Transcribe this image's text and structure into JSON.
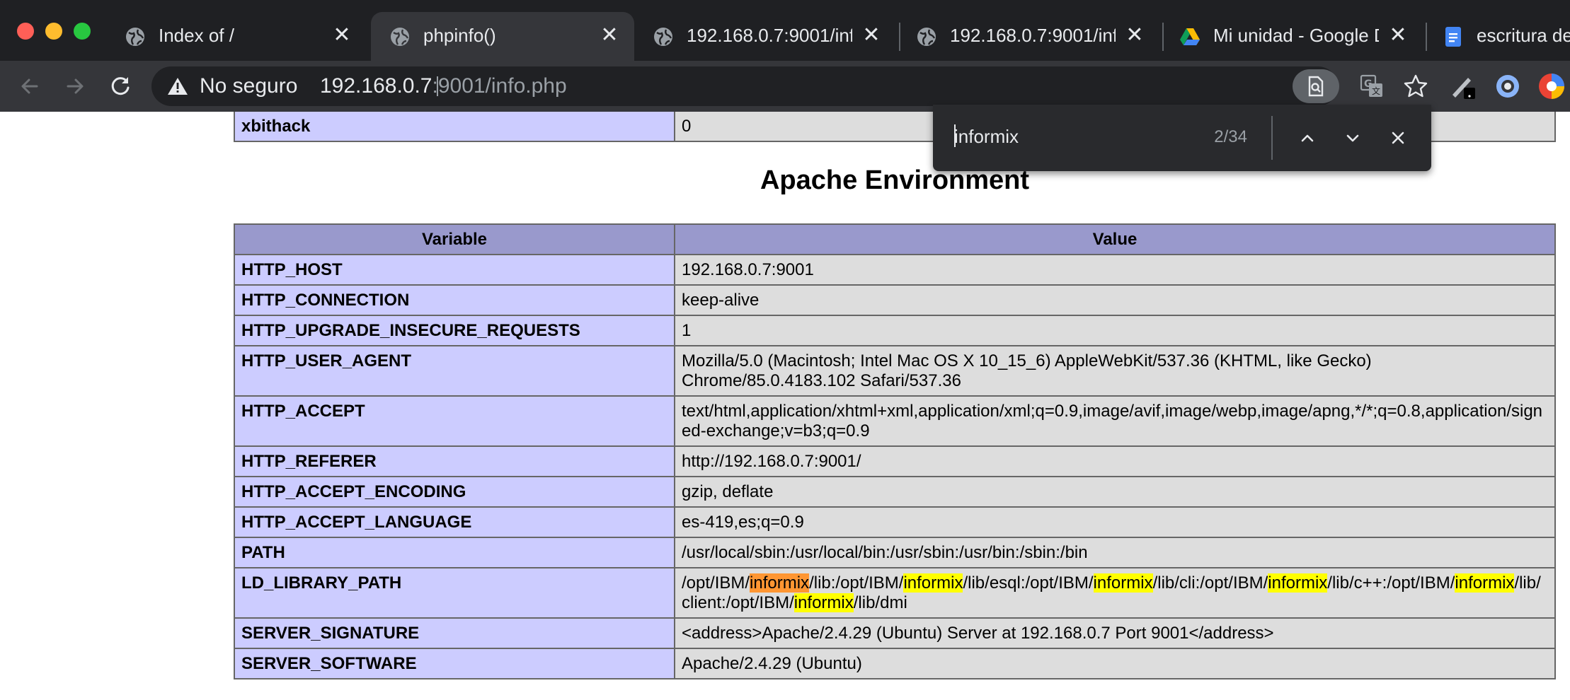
{
  "tabs": [
    {
      "title": "Index of /",
      "favicon": "globe-icon",
      "active": false
    },
    {
      "title": "phpinfo()",
      "favicon": "globe-icon",
      "active": true
    },
    {
      "title": "192.168.0.7:9001/info",
      "favicon": "globe-icon",
      "active": false
    },
    {
      "title": "192.168.0.7:9001/info",
      "favicon": "globe-icon",
      "active": false
    },
    {
      "title": "Mi unidad - Google D",
      "favicon": "google-drive-icon",
      "active": false
    },
    {
      "title": "escritura de",
      "favicon": "google-docs-icon",
      "active": false
    }
  ],
  "omnibox": {
    "security_label": "No seguro",
    "url_host": "192.168.0.7",
    "url_rest": ":9001/info.php"
  },
  "find_bar": {
    "query": "informix",
    "match_count": "2/34"
  },
  "top_row": {
    "name": "xbithack",
    "value": "0"
  },
  "section_title": "Apache Environment",
  "table": {
    "headers": [
      "Variable",
      "Value"
    ],
    "rows": [
      {
        "name": "HTTP_HOST",
        "value": "192.168.0.7:9001"
      },
      {
        "name": "HTTP_CONNECTION",
        "value": "keep-alive"
      },
      {
        "name": "HTTP_UPGRADE_INSECURE_REQUESTS",
        "value": "1"
      },
      {
        "name": "HTTP_USER_AGENT",
        "value": "Mozilla/5.0 (Macintosh; Intel Mac OS X 10_15_6) AppleWebKit/537.36 (KHTML, like Gecko) Chrome/85.0.4183.102 Safari/537.36"
      },
      {
        "name": "HTTP_ACCEPT",
        "value": "text/html,application/xhtml+xml,application/xml;q=0.9,image/avif,image/webp,image/apng,*/*;q=0.8,application/signed-exchange;v=b3;q=0.9"
      },
      {
        "name": "HTTP_REFERER",
        "value": "http://192.168.0.7:9001/"
      },
      {
        "name": "HTTP_ACCEPT_ENCODING",
        "value": "gzip, deflate"
      },
      {
        "name": "HTTP_ACCEPT_LANGUAGE",
        "value": "es-419,es;q=0.9"
      },
      {
        "name": "PATH",
        "value": "/usr/local/sbin:/usr/local/bin:/usr/sbin:/usr/bin:/sbin:/bin"
      },
      {
        "name": "LD_LIBRARY_PATH",
        "value": "/opt/IBM/informix/lib:/opt/IBM/informix/lib/esql:/opt/IBM/informix/lib/cli:/opt/IBM/informix/lib/c++:/opt/IBM/informix/lib/client:/opt/IBM/informix/lib/dmi"
      },
      {
        "name": "SERVER_SIGNATURE",
        "value": "<address>Apache/2.4.29 (Ubuntu) Server at 192.168.0.7 Port 9001</address>"
      },
      {
        "name": "SERVER_SOFTWARE",
        "value": "Apache/2.4.29 (Ubuntu)"
      }
    ]
  },
  "colors": {
    "tabstrip_bg": "#1f2023",
    "toolbar_bg": "#35363a",
    "php_header": "#9999cc",
    "php_name_cell": "#ccccff",
    "php_value_cell": "#dddddd",
    "find_highlight": "#ffff00",
    "find_current": "#ff9632"
  }
}
